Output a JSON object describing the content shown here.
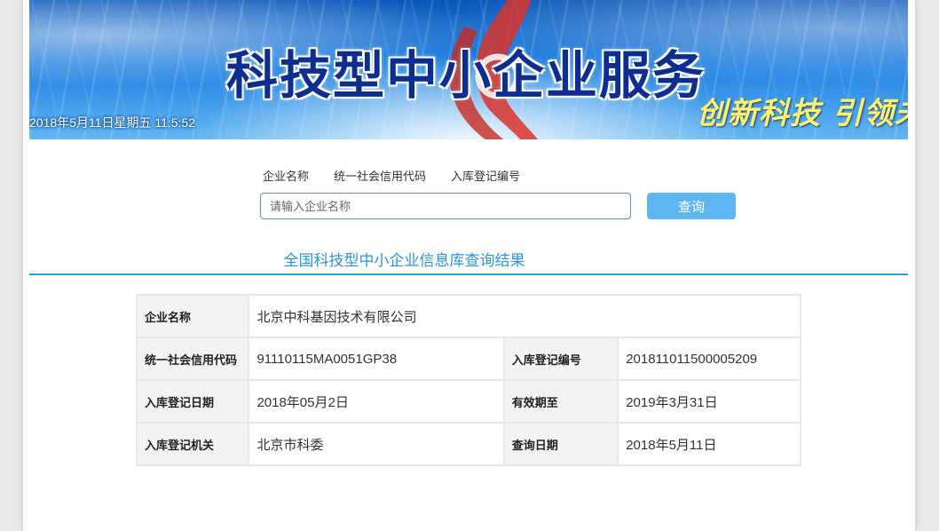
{
  "banner": {
    "title": "科技型中小企业服务",
    "slogan": "创新科技 引领未来",
    "datetime": "2018年5月11日星期五 11:5:52"
  },
  "search": {
    "tabs": [
      "企业名称",
      "统一社会信用代码",
      "入库登记编号"
    ],
    "placeholder": "请输入企业名称",
    "button_label": "查询"
  },
  "results": {
    "heading": "全国科技型中小企业信息库查询结果",
    "company_name_label": "企业名称",
    "company_name": "北京中科基因技术有限公司",
    "credit_code_label": "统一社会信用代码",
    "credit_code": "91110115MA0051GP38",
    "reg_number_label": "入库登记编号",
    "reg_number": "201811011500005209",
    "reg_date_label": "入库登记日期",
    "reg_date": "2018年05月2日",
    "valid_until_label": "有效期至",
    "valid_until": "2019年3月31日",
    "reg_authority_label": "入库登记机关",
    "reg_authority": "北京市科委",
    "query_date_label": "查询日期",
    "query_date": "2018年5月11日"
  }
}
